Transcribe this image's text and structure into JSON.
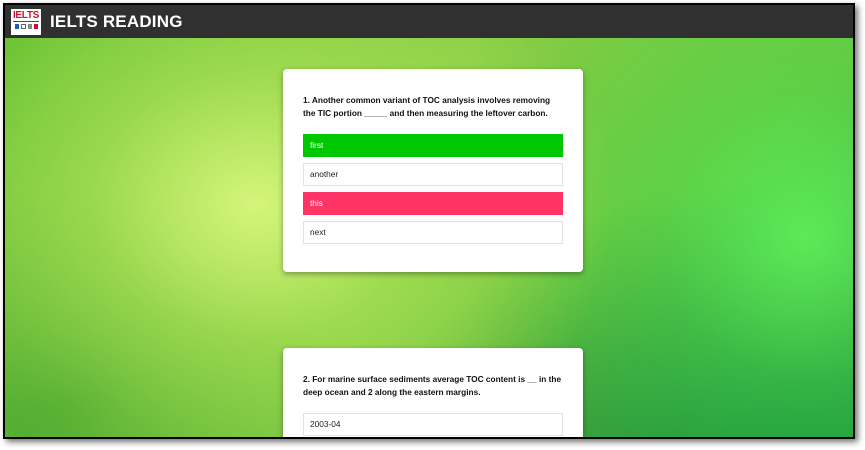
{
  "header": {
    "logo_text": "IELTS",
    "title": "IELTS READING"
  },
  "questions": [
    {
      "text": "1. Another common variant of TOC analysis involves removing the TIC portion _____ and then measuring the leftover carbon.",
      "options": [
        {
          "label": "first",
          "state": "correct"
        },
        {
          "label": "another",
          "state": "default"
        },
        {
          "label": "this",
          "state": "wrong"
        },
        {
          "label": "next",
          "state": "default"
        }
      ]
    },
    {
      "text": "2. For marine surface sediments average TOC content is __ in the deep ocean and 2 along the eastern margins.",
      "options": [
        {
          "label": "2003-04",
          "state": "default"
        }
      ]
    }
  ],
  "colors": {
    "header_bg": "#303030",
    "correct": "#00c800",
    "wrong": "#ff3366"
  },
  "icons": [
    "ielts-logo-icon"
  ]
}
